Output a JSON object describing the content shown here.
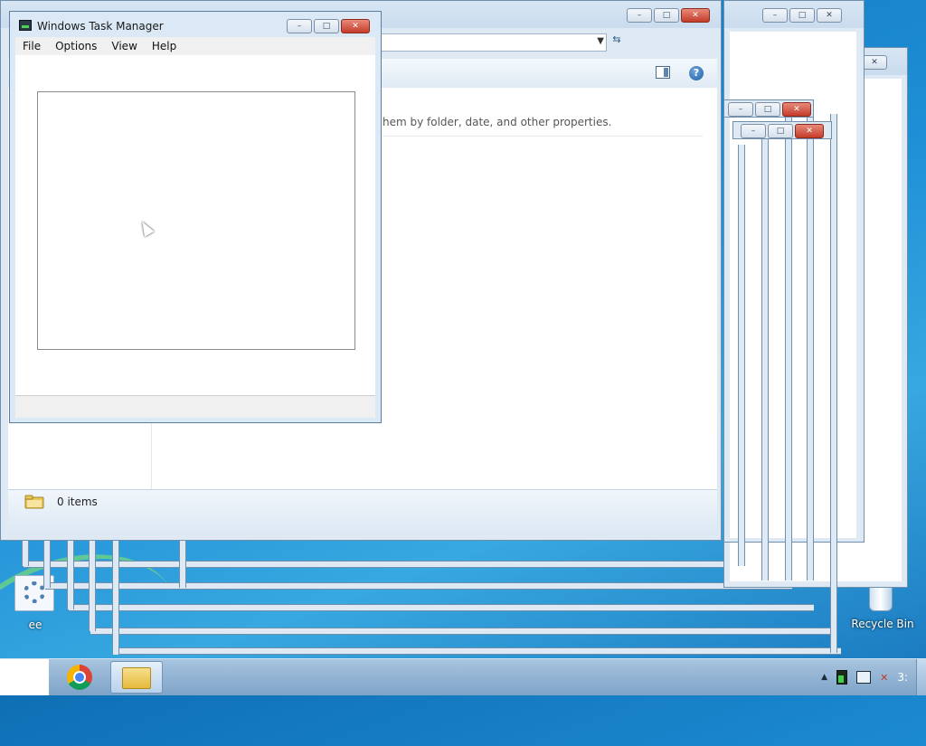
{
  "task_manager": {
    "title": "Windows Task Manager",
    "menu": [
      "File",
      "Options",
      "View",
      "Help"
    ],
    "caption_buttons": {
      "minimize": "minimize-icon",
      "maximize": "maximize-icon",
      "close": "close-icon"
    }
  },
  "explorer": {
    "hint_text": "hem by folder, date, and other properties.",
    "status_text": "0 items",
    "toolbar_icons": [
      "preview-pane-icon",
      "help-icon"
    ],
    "help_glyph": "?"
  },
  "desktop": {
    "icons": [
      {
        "label": "ee",
        "icon": "settings-icon"
      },
      {
        "label": "Recycle Bin",
        "icon": "recycle-bin-icon"
      }
    ]
  },
  "taskbar": {
    "pinned": [
      {
        "name": "chrome",
        "icon": "chrome-icon",
        "active": false
      },
      {
        "name": "explorer",
        "icon": "folder-icon",
        "active": true
      }
    ],
    "tray": {
      "arrow": "▲",
      "clock_partial": "3:"
    }
  },
  "colors": {
    "accent": "#1e8fd6",
    "close_button": "#c43d2a"
  }
}
